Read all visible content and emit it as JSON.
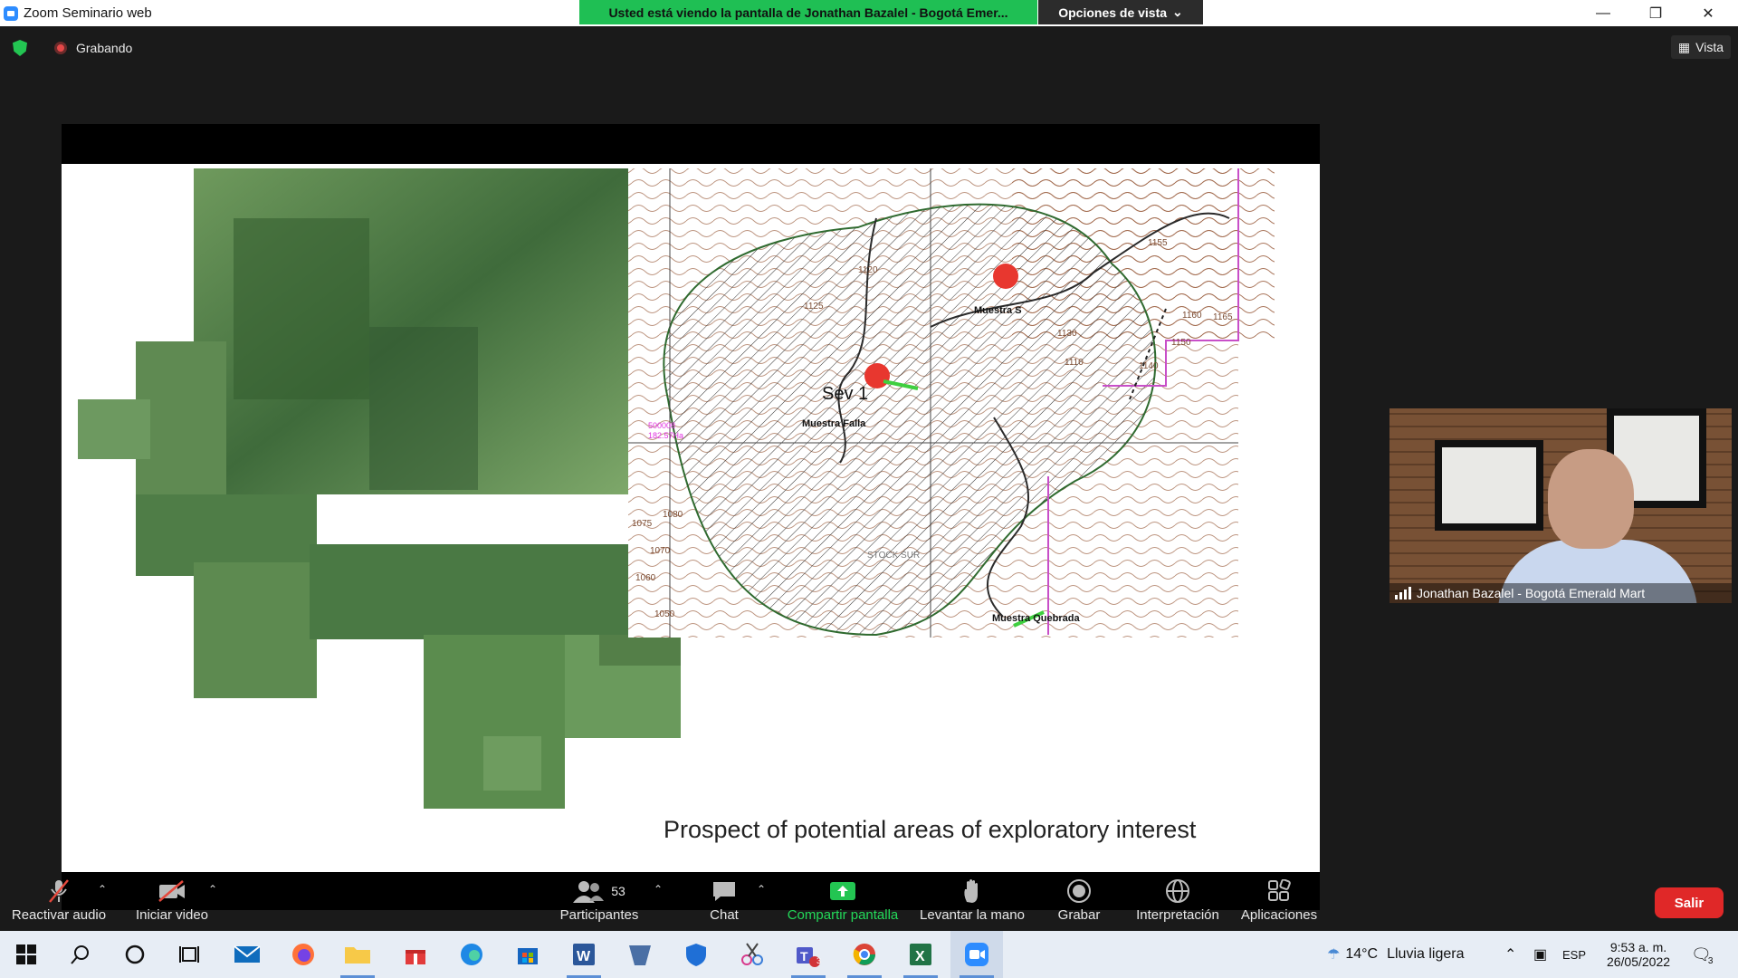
{
  "window": {
    "title": "Zoom Seminario web",
    "share_status": "Usted está viendo la pantalla de Jonathan Bazalel - Bogotá Emer...",
    "view_options": "Opciones de vista"
  },
  "meeting": {
    "recording_label": "Grabando",
    "view_button": "Vista"
  },
  "slide": {
    "caption": "Prospect of potential areas of exploratory interest",
    "map_labels": {
      "sev": "Sev 1",
      "muestra_falla": "Muestra Falla",
      "muestra_s": "Muestra S",
      "muestra_quebrada": "Muestra Quebrada",
      "code": "500008",
      "area": "182.57Ha",
      "stock": "STOCK SUR",
      "contours": [
        "1160",
        "1165",
        "1150",
        "1140",
        "1130",
        "1110",
        "1075",
        "1070",
        "1060",
        "1050",
        "1080",
        "1120",
        "1125",
        "1155"
      ]
    }
  },
  "video": {
    "participant_name": "Jonathan Bazalel - Bogotá Emerald Mart"
  },
  "toolbar": {
    "unmute": "Reactivar audio",
    "start_video": "Iniciar video",
    "participants": "Participantes",
    "participants_count": "53",
    "chat": "Chat",
    "share_screen": "Compartir pantalla",
    "raise_hand": "Levantar la mano",
    "record": "Grabar",
    "interpretation": "Interpretación",
    "apps": "Aplicaciones",
    "leave": "Salir"
  },
  "taskbar": {
    "temperature": "14°C",
    "weather": "Lluvia ligera",
    "language": "ESP",
    "time": "9:53 a. m.",
    "date": "26/05/2022",
    "notifications": "3",
    "teams_badge": "3"
  },
  "colors": {
    "share_green": "#1fbf54",
    "leave_red": "#e02828",
    "pin_red": "#e8372f"
  }
}
